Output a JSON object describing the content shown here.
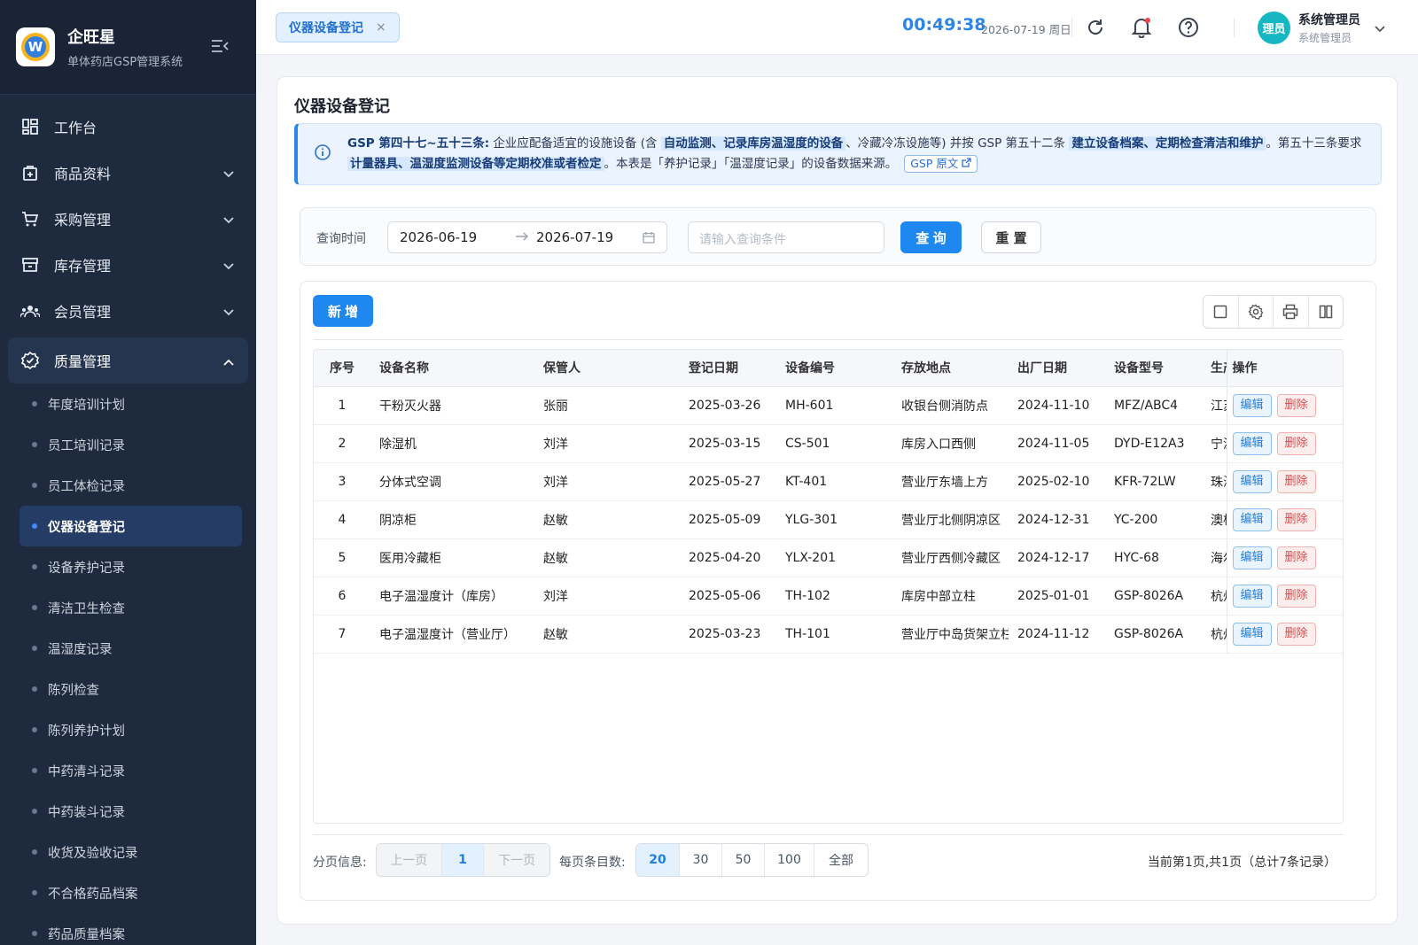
{
  "brand": {
    "name": "企旺星",
    "subtitle": "单体药店GSP管理系统",
    "logo_letter": "W"
  },
  "sidebar": {
    "items": [
      {
        "label": "工作台",
        "icon": "dashboard-icon"
      },
      {
        "label": "商品资料",
        "icon": "goods-icon"
      },
      {
        "label": "采购管理",
        "icon": "cart-icon"
      },
      {
        "label": "库存管理",
        "icon": "inventory-icon"
      },
      {
        "label": "会员管理",
        "icon": "members-icon"
      },
      {
        "label": "质量管理",
        "icon": "quality-icon"
      }
    ],
    "quality_sub": [
      "年度培训计划",
      "员工培训记录",
      "员工体检记录",
      "仪器设备登记",
      "设备养护记录",
      "清洁卫生检查",
      "温湿度记录",
      "陈列检查",
      "陈列养护计划",
      "中药清斗记录",
      "中药装斗记录",
      "收货及验收记录",
      "不合格药品档案",
      "药品质量档案"
    ],
    "active_sub": "仪器设备登记"
  },
  "topbar": {
    "tab_label": "仪器设备登记",
    "tab_close": "×",
    "clock": "00:49:38",
    "date": "2026-07-19 周日",
    "avatar_text": "理员",
    "user_name": "系统管理员",
    "user_role": "系统管理员"
  },
  "page": {
    "title": "仪器设备登记",
    "notice": {
      "p1": "GSP 第四十七~五十三条:",
      "p2": " 企业应配备适宜的设施设备 (含 ",
      "h1": "自动监测、记录库房温湿度的设备",
      "p3": "、冷藏冷冻设施等) 并按 GSP 第五十二条 ",
      "h2": "建立设备档案、定期检查清洁和维护",
      "p4": "。第五十三条要求 ",
      "h3": "计量器具、温湿度监测设备等定期校准或者检定",
      "p5": "。本表是「养护记录」「温湿度记录」的设备数据来源。",
      "link": "GSP 原文"
    },
    "filter": {
      "label": "查询时间",
      "date_from": "2026-06-19",
      "date_to": "2026-07-19",
      "query_placeholder": "请输入查询条件",
      "query_button": "查 询",
      "reset_button": "重 置"
    },
    "add_button": "新 增",
    "table": {
      "columns": [
        "序号",
        "设备名称",
        "保管人",
        "登记日期",
        "设备编号",
        "存放地点",
        "出厂日期",
        "设备型号",
        "生产厂家",
        "操作"
      ],
      "rows": [
        [
          "1",
          "干粉灭火器",
          "张丽",
          "2025-03-26",
          "MH-601",
          "收银台侧消防点",
          "2024-11-10",
          "MFZ/ABC4",
          "江苏"
        ],
        [
          "2",
          "除湿机",
          "刘洋",
          "2025-03-15",
          "CS-501",
          "库房入口西侧",
          "2024-11-05",
          "DYD-E12A3",
          "宁波"
        ],
        [
          "3",
          "分体式空调",
          "刘洋",
          "2025-05-27",
          "KT-401",
          "营业厅东墙上方",
          "2025-02-10",
          "KFR-72LW",
          "珠海"
        ],
        [
          "4",
          "阴凉柜",
          "赵敏",
          "2025-05-09",
          "YLG-301",
          "营业厅北侧阴凉区",
          "2024-12-31",
          "YC-200",
          "澳柯"
        ],
        [
          "5",
          "医用冷藏柜",
          "赵敏",
          "2025-04-20",
          "YLX-201",
          "营业厅西侧冷藏区",
          "2024-12-17",
          "HYC-68",
          "海尔"
        ],
        [
          "6",
          "电子温湿度计（库房）",
          "刘洋",
          "2025-05-06",
          "TH-102",
          "库房中部立柱",
          "2025-01-01",
          "GSP-8026A",
          "杭州"
        ],
        [
          "7",
          "电子温湿度计（营业厅）",
          "赵敏",
          "2025-03-23",
          "TH-101",
          "营业厅中岛货架立柱",
          "2024-11-12",
          "GSP-8026A",
          "杭州"
        ]
      ],
      "edit_label": "编辑",
      "delete_label": "删除"
    },
    "pagination": {
      "info_label": "分页信息:",
      "prev": "上一页",
      "current": "1",
      "next": "下一页",
      "size_label": "每页条目数:",
      "sizes": [
        "20",
        "30",
        "50",
        "100",
        "全部"
      ],
      "active_size": "20",
      "summary": "当前第1页,共1页（总计7条记录）"
    }
  },
  "colors": {
    "accent": "#1e88f0",
    "sidebar_bg": "#1e2a3e",
    "danger": "#e04848"
  }
}
